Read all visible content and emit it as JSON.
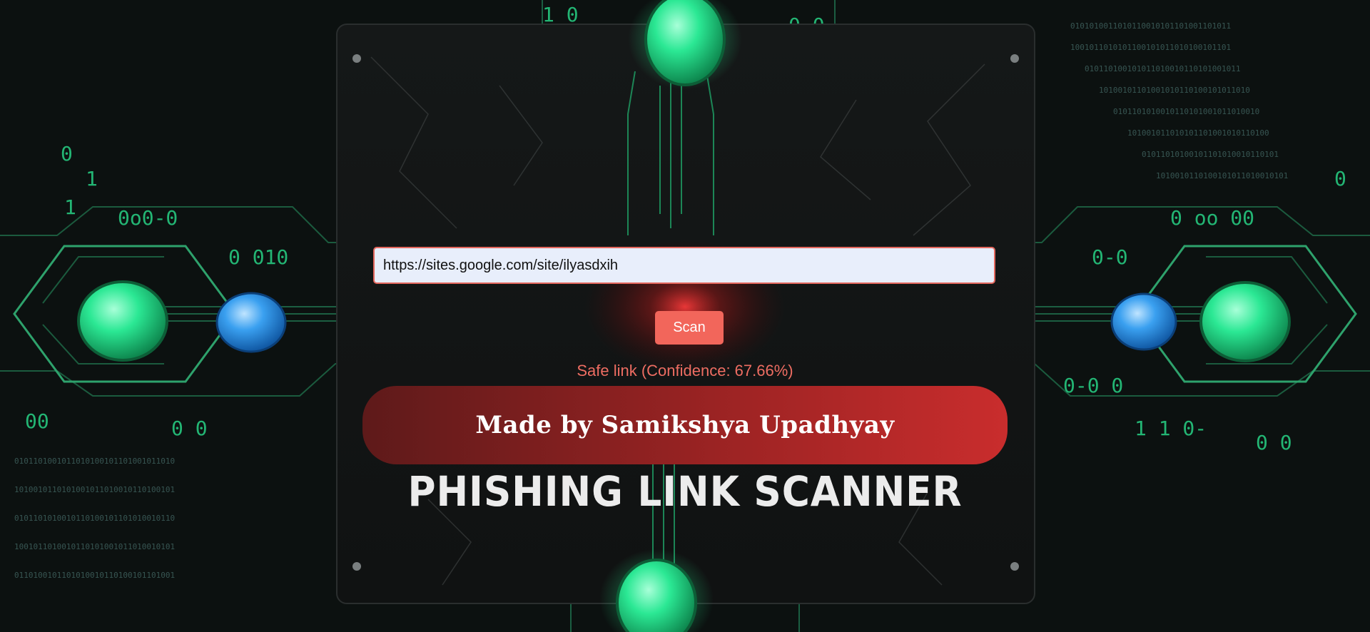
{
  "scanner": {
    "url_value": "https://sites.google.com/site/ilyasdxih",
    "scan_label": "Scan",
    "result_text": "Safe link (Confidence: 67.66%)"
  },
  "banner": {
    "credit": "Made by Samikshya Upadhyay",
    "title": "PHISHING LINK SCANNER"
  },
  "colors": {
    "accent": "#f2665b",
    "circuit_green": "#22e08a",
    "node_blue": "#3aa0f0",
    "input_bg": "#e8eefb"
  }
}
